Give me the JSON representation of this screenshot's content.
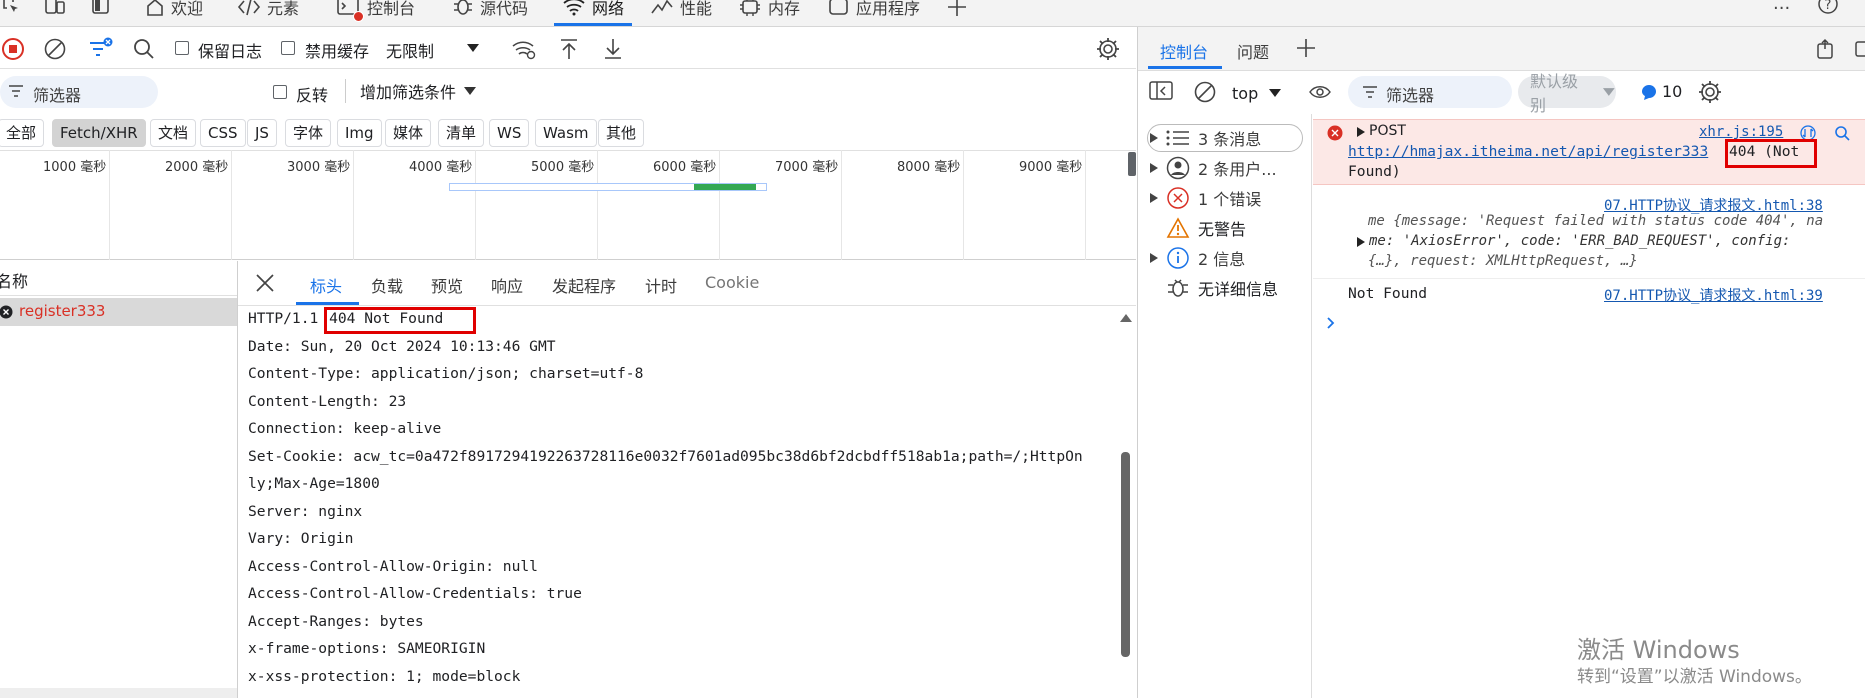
{
  "top_tabs": [
    {
      "label": "欢迎",
      "icon": "home-icon"
    },
    {
      "label": "元素",
      "icon": "code-icon"
    },
    {
      "label": "控制台",
      "icon": "console-icon"
    },
    {
      "label": "源代码",
      "icon": "bug-icon"
    },
    {
      "label": "网络",
      "icon": "wifi-icon",
      "active": true
    },
    {
      "label": "性能",
      "icon": "performance-icon"
    },
    {
      "label": "内存",
      "icon": "memory-icon"
    },
    {
      "label": "应用程序",
      "icon": "application-icon"
    }
  ],
  "network": {
    "toolbar": {
      "preserve_log": "保留日志",
      "disable_cache": "禁用缓存",
      "throttle": "无限制"
    },
    "filter": {
      "placeholder": "筛选器",
      "invert": "反转",
      "more_filters": "增加筛选条件"
    },
    "types": [
      "全部",
      "Fetch/XHR",
      "文档",
      "CSS",
      "JS",
      "字体",
      "Img",
      "媒体",
      "清单",
      "WS",
      "Wasm",
      "其他"
    ],
    "active_type": "Fetch/XHR",
    "timeline_labels": [
      "1000 毫秒",
      "2000 毫秒",
      "3000 毫秒",
      "4000 毫秒",
      "5000 毫秒",
      "6000 毫秒",
      "7000 毫秒",
      "8000 毫秒",
      "9000 毫秒"
    ],
    "list": {
      "header": "名称",
      "rows": [
        {
          "name": "register333",
          "status": "error"
        }
      ]
    },
    "detail_tabs": [
      "标头",
      "负载",
      "预览",
      "响应",
      "发起程序",
      "计时",
      "Cookie"
    ],
    "active_detail_tab": "标头",
    "status_line": {
      "protocol": "HTTP/1.1",
      "status": "404 Not Found"
    },
    "headers": [
      "Date: Sun, 20 Oct 2024 10:13:46 GMT",
      "Content-Type: application/json; charset=utf-8",
      "Content-Length: 23",
      "Connection: keep-alive",
      "Set-Cookie: acw_tc=0a472f8917294192263728116e0032f7601ad095bc38d6bf2dcbdff518ab1a;path=/;HttpOn",
      "ly;Max-Age=1800",
      "Server: nginx",
      "Vary: Origin",
      "Access-Control-Allow-Origin: null",
      "Access-Control-Allow-Credentials: true",
      "Accept-Ranges: bytes",
      "x-frame-options: SAMEORIGIN",
      "x-xss-protection: 1; mode=block"
    ]
  },
  "console": {
    "tabs": [
      "控制台",
      "问题"
    ],
    "active_tab": "控制台",
    "context": "top",
    "filter_placeholder": "筛选器",
    "level": "默认级别",
    "issue_count": "10",
    "sidebar": [
      {
        "label": "3 条消息",
        "icon": "list-icon"
      },
      {
        "label": "2 条用户...",
        "icon": "user-icon"
      },
      {
        "label": "1 个错误",
        "icon": "error-icon"
      },
      {
        "label": "无警告",
        "icon": "warning-icon"
      },
      {
        "label": "2 信息",
        "icon": "info-icon"
      },
      {
        "label": "无详细信息",
        "icon": "bug-icon"
      }
    ],
    "messages": {
      "error_method": "POST",
      "error_source": "xhr.js:195",
      "error_url": "http://hmajax.itheima.net/api/register333",
      "error_status_1": "404 (Not",
      "error_status_2": "Found)",
      "log1_source": "07.HTTP协议_请求报文.html:38",
      "log1_line1": "me {message: 'Request failed with status code 404', na",
      "log1_line2": "me: 'AxiosError', code: 'ERR_BAD_REQUEST', config:",
      "log1_line3": "{…}, request: XMLHttpRequest, …}",
      "log2_text": "Not Found",
      "log2_source": "07.HTTP协议_请求报文.html:39"
    }
  },
  "watermark": {
    "line1": "激活 Windows",
    "line2": "转到“设置”以激活 Windows。"
  },
  "colors": {
    "accent": "#1a73e8",
    "error": "#d93025",
    "highlight_box": "#e00000",
    "error_bg": "#fce8e6"
  }
}
